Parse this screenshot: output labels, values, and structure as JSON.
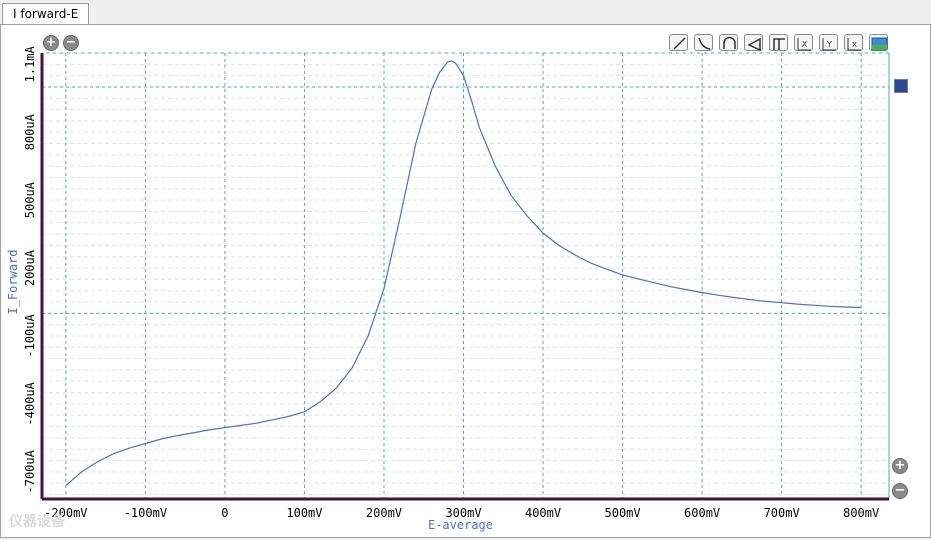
{
  "tab": {
    "label": "I forward-E"
  },
  "legend": {
    "swatch_color": "#2b4a8f"
  },
  "toolbar": {
    "icons": [
      "line-tool-icon",
      "curve-tool-icon",
      "arc-tool-icon",
      "speaker-tool-icon",
      "peak-tool-icon",
      "zoom-x-icon",
      "zoom-y-icon",
      "zoom-xy-icon",
      "image-export-icon"
    ]
  },
  "watermark": {
    "text": "仪器设备"
  },
  "colors": {
    "series": "#4a72c4",
    "grid": "#3fb6a8",
    "axis": "#4b0f3f",
    "label": "#4a72c4"
  },
  "chart_data": {
    "type": "line",
    "title": "",
    "xlabel": "E-average",
    "ylabel": "I_Forward",
    "xlim": [
      -230,
      835
    ],
    "ylim": [
      -820,
      1150
    ],
    "x_unit": "mV",
    "x_ticks": [
      -200,
      -100,
      0,
      100,
      200,
      300,
      400,
      500,
      600,
      700,
      800
    ],
    "x_tick_labels": [
      "-200mV",
      "-100mV",
      "0",
      "100mV",
      "200mV",
      "300mV",
      "400mV",
      "500mV",
      "600mV",
      "700mV",
      "800mV"
    ],
    "y_ticks": [
      -700,
      -400,
      -100,
      200,
      500,
      800,
      1100
    ],
    "y_tick_labels": [
      "-700uA",
      "-400uA",
      "-100uA",
      "200uA",
      "500uA",
      "800uA",
      "1.1mA"
    ],
    "y_unit": "uA",
    "grid": true,
    "legend": "top-right",
    "series": [
      {
        "x": [
          -200,
          -180,
          -160,
          -140,
          -120,
          -100,
          -80,
          -60,
          -40,
          -20,
          0,
          20,
          40,
          60,
          80,
          100,
          120,
          140,
          160,
          180,
          200,
          220,
          240,
          260,
          270,
          280,
          285,
          290,
          300,
          310,
          320,
          340,
          360,
          380,
          400,
          420,
          440,
          460,
          480,
          500,
          520,
          540,
          560,
          580,
          600,
          620,
          640,
          660,
          680,
          700,
          720,
          740,
          760,
          780,
          800
        ],
        "y": [
          -760,
          -700,
          -655,
          -620,
          -595,
          -575,
          -555,
          -540,
          -528,
          -515,
          -505,
          -495,
          -485,
          -470,
          -455,
          -435,
          -390,
          -330,
          -240,
          -100,
          110,
          420,
          750,
          990,
          1065,
          1110,
          1115,
          1105,
          1050,
          940,
          820,
          650,
          520,
          430,
          355,
          300,
          258,
          222,
          195,
          170,
          152,
          135,
          118,
          105,
          92,
          80,
          70,
          61,
          53,
          47,
          41,
          36,
          31,
          28,
          26
        ]
      }
    ]
  }
}
